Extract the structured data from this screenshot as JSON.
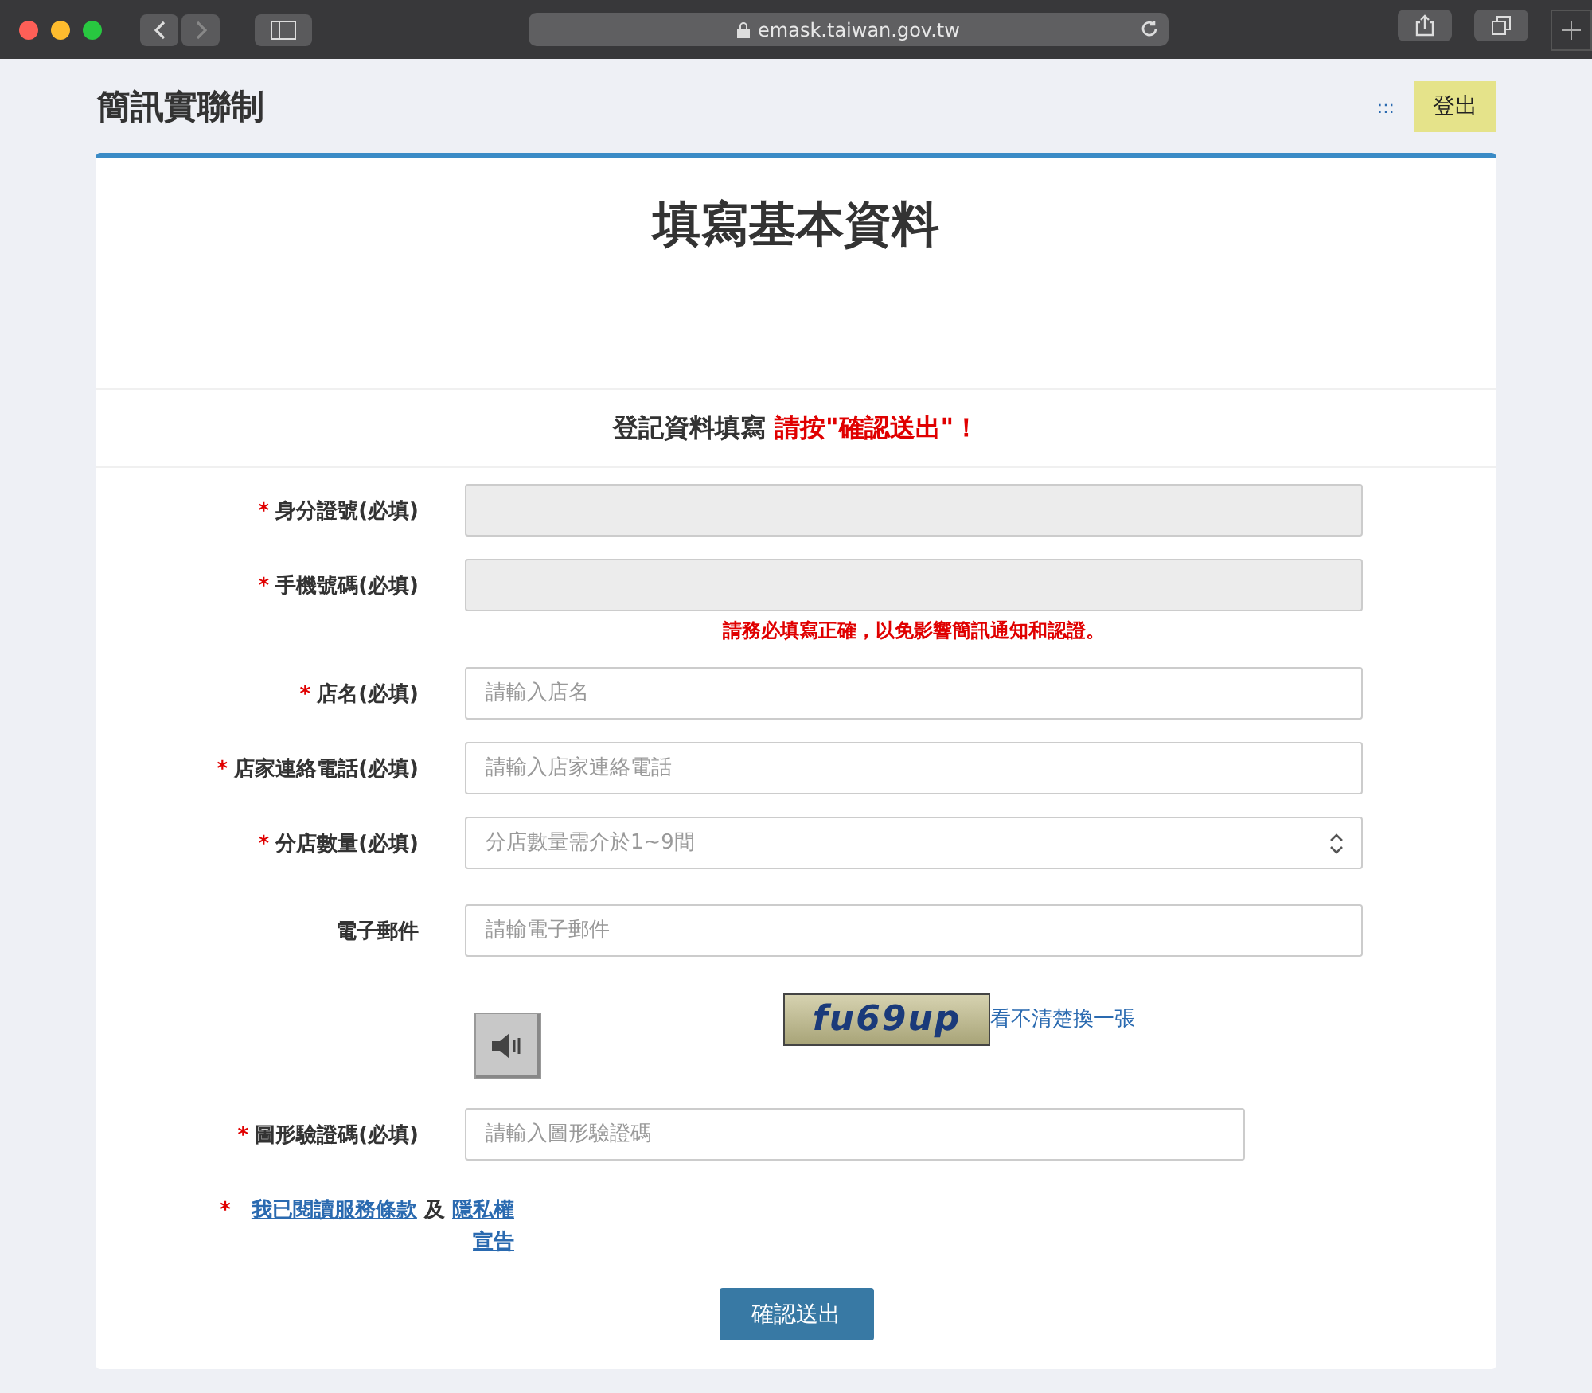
{
  "browser": {
    "url": "emask.taiwan.gov.tw"
  },
  "header": {
    "title": "簡訊實聯制",
    "menu_glyph": ":::",
    "logout": "登出"
  },
  "card": {
    "title": "填寫基本資料",
    "notice": "登記資料填寫 ",
    "notice_emphasis": "請按\"確認送出\"！"
  },
  "fields": [
    {
      "label": "身分證號(必填)",
      "mark": "*",
      "kind": "text",
      "disabled": true
    },
    {
      "label": "手機號碼(必填)",
      "mark": "*",
      "kind": "text",
      "disabled": true,
      "hint": "請務必填寫正確，以免影響簡訊通知和認證。"
    },
    {
      "label": "店名(必填)",
      "mark": "*",
      "kind": "text",
      "disabled": false,
      "placeholder": "請輸入店名"
    },
    {
      "label": "店家連絡電話(必填)",
      "mark": "*",
      "kind": "text",
      "disabled": false,
      "placeholder": "請輸入店家連絡電話"
    },
    {
      "label": "分店數量(必填)",
      "mark": "*",
      "kind": "number",
      "disabled": false,
      "placeholder": "分店數量需介於1~9間"
    },
    {
      "label": "電子郵件",
      "kind": "text",
      "disabled": false,
      "placeholder": "請輸電子郵件"
    }
  ],
  "captcha": {
    "image_text": "fu69up",
    "refresh_link": "看不清楚換一張",
    "label": "圖形驗證碼(必填)",
    "mark": "*",
    "placeholder": "請輸入圖形驗證碼"
  },
  "terms": {
    "mark": "*",
    "link1": "我已閱讀服務條款",
    "joiner": "及",
    "link2a": "隱私權",
    "link2b": "宣告"
  },
  "submit": "確認送出"
}
